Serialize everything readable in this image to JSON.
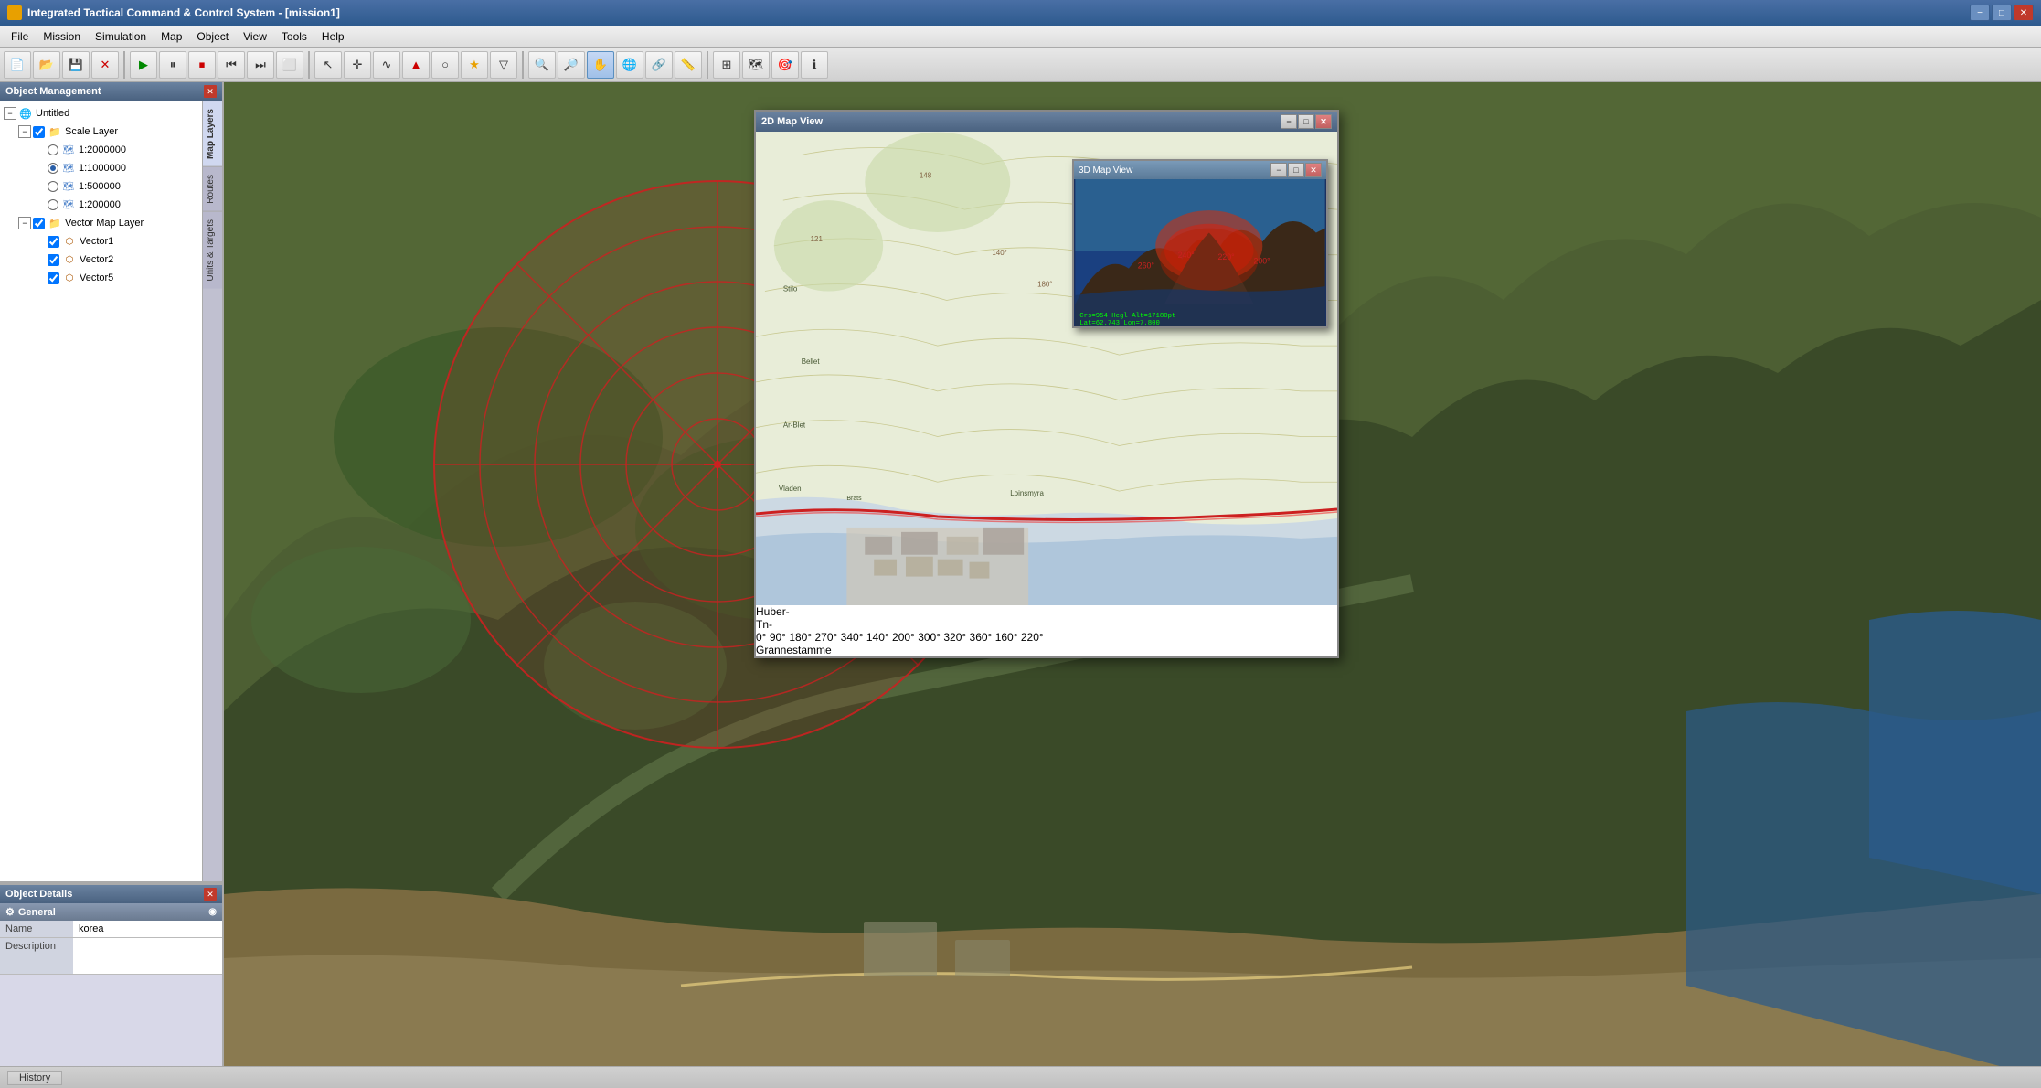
{
  "titleBar": {
    "appIcon": "globe",
    "title": "Integrated Tactical Command & Control System - [mission1]",
    "minimizeBtn": "−",
    "maximizeBtn": "□",
    "closeBtn": "✕"
  },
  "menuBar": {
    "items": [
      "File",
      "Mission",
      "Simulation",
      "Map",
      "Object",
      "View",
      "Tools",
      "Help"
    ]
  },
  "toolbar": {
    "groups": [
      [
        "new",
        "open",
        "save",
        "delete",
        "play",
        "pause",
        "stop",
        "rewind",
        "forward",
        "record"
      ],
      [
        "cursor",
        "cross",
        "line",
        "measure",
        "circle",
        "star",
        "filter"
      ],
      [
        "zoomIn",
        "zoomOut",
        "pan",
        "globe",
        "link",
        "ruler"
      ],
      [
        "units",
        "route",
        "target",
        "info"
      ]
    ]
  },
  "leftPanel": {
    "objectManagement": {
      "title": "Object Management",
      "tree": {
        "root": {
          "label": "Untitled",
          "expanded": true,
          "children": [
            {
              "label": "Scale Layer",
              "type": "folder",
              "expanded": true,
              "checked": true,
              "children": [
                {
                  "label": "1:2000000",
                  "type": "scale",
                  "radio": true,
                  "selected": false
                },
                {
                  "label": "1:1000000",
                  "type": "scale",
                  "radio": true,
                  "selected": true
                },
                {
                  "label": "1:500000",
                  "type": "scale",
                  "radio": true,
                  "selected": false
                },
                {
                  "label": "1:200000",
                  "type": "scale",
                  "radio": true,
                  "selected": false
                }
              ]
            },
            {
              "label": "Vector Map Layer",
              "type": "folder",
              "expanded": true,
              "checked": true,
              "children": [
                {
                  "label": "Vector1",
                  "type": "vector",
                  "checked": true
                },
                {
                  "label": "Vector2",
                  "type": "vector",
                  "checked": true
                },
                {
                  "label": "Vector5",
                  "type": "vector",
                  "checked": true
                }
              ]
            }
          ]
        }
      }
    },
    "sidebarTabs": [
      "Map Layers",
      "Routes",
      "Units & Targets"
    ],
    "objectDetails": {
      "title": "Object Details",
      "sections": [
        {
          "label": "General",
          "icon": "gear",
          "fields": [
            {
              "name": "Name",
              "value": "korea"
            },
            {
              "name": "Description",
              "value": ""
            }
          ]
        }
      ]
    }
  },
  "mapArea": {
    "satelliteView": {
      "description": "Satellite imagery of mountainous Korean terrain with coastline"
    },
    "tacticalOverlay": {
      "title": "2D Map View",
      "description": "Topographic map with tactical range circles",
      "subWindow3D": {
        "title": "3D Map View",
        "coordInfo": "Crs=954 Hegl Alt=17180pt  Lat=62.743 Lon=7.800"
      }
    },
    "rangeCircles": {
      "count": 8,
      "color": "#cc0000",
      "fillColor": "rgba(200,0,0,0.15)"
    }
  },
  "statusBar": {
    "historyTab": "History"
  }
}
